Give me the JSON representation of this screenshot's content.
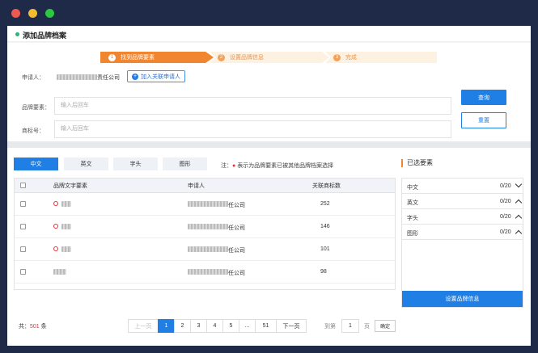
{
  "window": {
    "colors": {
      "close": "#ee5a52",
      "minimize": "#f5bd2e",
      "maximize": "#2bc840"
    }
  },
  "header": {
    "title": "添加品牌档案"
  },
  "steps": [
    {
      "num": "1",
      "label": "找到品牌要素"
    },
    {
      "num": "2",
      "label": "设置品牌信息"
    },
    {
      "num": "3",
      "label": "完成"
    }
  ],
  "form": {
    "applicant_label": "申请人：",
    "applicant_value_suffix": "责任公司",
    "add_applicant_label": "加入关联申请人",
    "brand_label": "品牌要素：",
    "brand_placeholder": "输入后回车",
    "trademark_label": "商标号：",
    "trademark_placeholder": "输入后回车",
    "query_label": "查询",
    "reset_label": "重置"
  },
  "tabs": [
    "中文",
    "英文",
    "字头",
    "图形"
  ],
  "note": {
    "prefix": "注：",
    "text": "表示为品牌要素已被其他品牌档案选择"
  },
  "table": {
    "headers": [
      "品牌文字要素",
      "申请人",
      "关联商标数"
    ],
    "rows": [
      {
        "applicant_suffix": "任公司",
        "count": "252",
        "selected_elsewhere": true
      },
      {
        "applicant_suffix": "任公司",
        "count": "146",
        "selected_elsewhere": true
      },
      {
        "applicant_suffix": "任公司",
        "count": "101",
        "selected_elsewhere": true
      },
      {
        "applicant_suffix": "任公司",
        "count": "98",
        "selected_elsewhere": false
      }
    ]
  },
  "selected": {
    "title": "已选要素",
    "items": [
      {
        "name": "中文",
        "count": "0/20",
        "chevron": "chevron-down"
      },
      {
        "name": "英文",
        "count": "0/20",
        "chevron": "chevron-up"
      },
      {
        "name": "字头",
        "count": "0/20",
        "chevron": "chevron-up"
      },
      {
        "name": "图形",
        "count": "0/20",
        "chevron": "chevron-up"
      }
    ],
    "button_label": "设置品牌信息"
  },
  "pagination": {
    "total_prefix": "共：",
    "total_count": "501",
    "total_suffix": " 条",
    "prev_label": "上一页",
    "pages": [
      "1",
      "2",
      "3",
      "4",
      "5",
      "...",
      "51"
    ],
    "current": "1",
    "next_label": "下一页",
    "goto_prefix": "到第",
    "goto_value": "1",
    "goto_suffix": "页",
    "confirm_label": "确定"
  }
}
